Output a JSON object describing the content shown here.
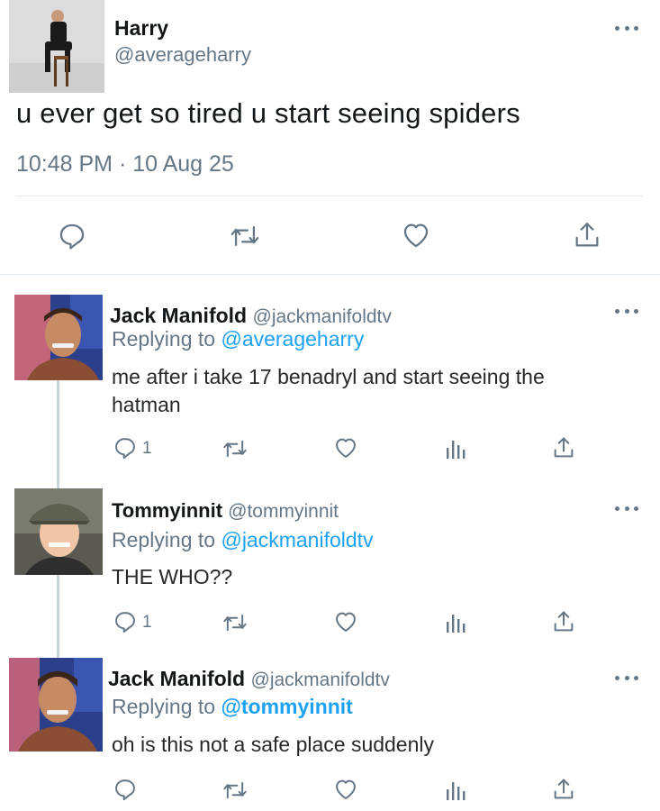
{
  "main_tweet": {
    "name": "Harry",
    "handle": "@averageharry",
    "text": "u ever get so tired u start seeing spiders",
    "timestamp": "10:48 PM · 10 Aug 25",
    "actions": [
      "reply-icon",
      "retweet-icon",
      "like-icon",
      "share-icon"
    ]
  },
  "replies": [
    {
      "name": "Jack Manifold",
      "handle": "@jackmanifoldtv",
      "replying_label": "Replying to",
      "replying_to": "@averageharry",
      "text_line1": "me after i take 17 benadryl and start seeing the",
      "text_line2": "hatman",
      "reply_count": "1"
    },
    {
      "name": "Tommyinnit",
      "handle": "@tommyinnit",
      "replying_label": "Replying to",
      "replying_to": "@jackmanifoldtv",
      "text_line1": "THE WHO??",
      "reply_count": "1"
    },
    {
      "name": "Jack Manifold",
      "handle": "@jackmanifoldtv",
      "replying_label": "Replying to",
      "replying_to": "@tommyinnit",
      "text_line1": "oh is this not a safe place suddenly",
      "reply_count": ""
    }
  ],
  "colors": {
    "link": "#1da1f2",
    "muted": "#657786",
    "text": "#14171a",
    "divider": "#e1e8ed"
  }
}
